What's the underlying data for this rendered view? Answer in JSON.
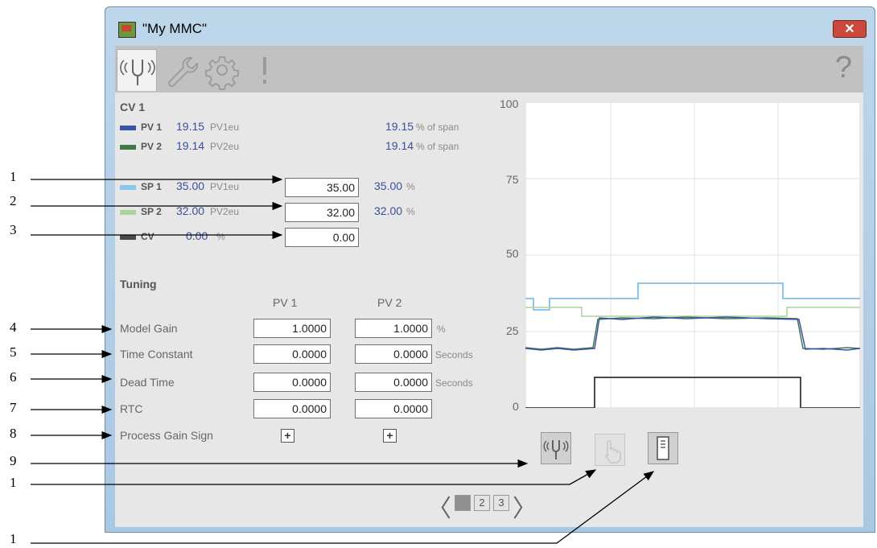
{
  "window": {
    "title": "\"My MMC\"",
    "close_label": "✕"
  },
  "tabs": [
    {
      "name": "operator-tab",
      "icon": "tuning-fork-icon",
      "active": true
    },
    {
      "name": "maintenance-tab",
      "icon": "wrench-icon",
      "active": false
    },
    {
      "name": "engineering-tab",
      "icon": "gear-icon",
      "active": false
    },
    {
      "name": "diagnostics-tab",
      "icon": "exclamation-icon",
      "active": false
    }
  ],
  "help": "?",
  "cv_section": {
    "title": "CV 1",
    "rows": [
      {
        "label": "PV 1",
        "value": "19.15",
        "eu": "PV1eu",
        "pct": "19.15",
        "pct_unit": "% of span",
        "color": "#3a51a8"
      },
      {
        "label": "PV 2",
        "value": "19.14",
        "eu": "PV2eu",
        "pct": "19.14",
        "pct_unit": "% of span",
        "color": "#3f7a45"
      },
      {
        "label": "SP 1",
        "value": "35.00",
        "eu": "PV1eu",
        "entry": "35.00",
        "pct": "35.00",
        "pct_unit": "%",
        "color": "#8cc6ec"
      },
      {
        "label": "SP 2",
        "value": "32.00",
        "eu": "PV2eu",
        "entry": "32.00",
        "pct": "32.00",
        "pct_unit": "%",
        "color": "#a9d49a"
      },
      {
        "label": "CV",
        "value": "0.00",
        "eu": "%",
        "entry": "0.00",
        "color": "#4a4a4a"
      }
    ]
  },
  "tuning": {
    "title": "Tuning",
    "col_headers": [
      "PV 1",
      "PV 2"
    ],
    "rows": [
      {
        "label": "Model Gain",
        "pv1": "1.0000",
        "pv2": "1.0000",
        "unit": "%"
      },
      {
        "label": "Time Constant",
        "pv1": "0.0000",
        "pv2": "0.0000",
        "unit": "Seconds"
      },
      {
        "label": "Dead Time",
        "pv1": "0.0000",
        "pv2": "0.0000",
        "unit": "Seconds"
      },
      {
        "label": "RTC",
        "pv1": "0.0000",
        "pv2": "0.0000",
        "unit": ""
      }
    ],
    "sign_label": "Process Gain Sign",
    "sign_pv1": "+",
    "sign_pv2": "+"
  },
  "trend": {
    "ticks": [
      "100",
      "75",
      "50",
      "25",
      "0"
    ]
  },
  "mode_buttons": [
    {
      "name": "operator-mode-button",
      "icon": "tuning-fork-icon",
      "enabled": true
    },
    {
      "name": "manual-mode-button",
      "icon": "hand-icon",
      "enabled": false
    },
    {
      "name": "program-mode-button",
      "icon": "server-icon",
      "enabled": true
    }
  ],
  "pager": {
    "pages": [
      "1",
      "2",
      "3"
    ],
    "active": "1",
    "prev": "〈",
    "next": "〉"
  },
  "callouts": [
    "1",
    "2",
    "3",
    "4",
    "5",
    "6",
    "7",
    "8",
    "9",
    "1",
    "1"
  ]
}
